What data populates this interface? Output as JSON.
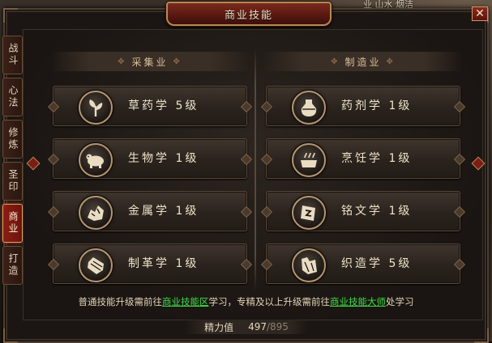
{
  "topright_text": "业   山水   烟洁",
  "window": {
    "title": "商业技能",
    "close_label": "✕"
  },
  "side_tabs": [
    {
      "label": "战斗",
      "active": false
    },
    {
      "label": "心法",
      "active": false
    },
    {
      "label": "修炼",
      "active": false
    },
    {
      "label": "圣印",
      "active": false
    },
    {
      "label": "商业",
      "active": true
    },
    {
      "label": "打造",
      "active": false
    }
  ],
  "columns": [
    {
      "header": "采集业",
      "skills": [
        {
          "label": "草药学  5级",
          "icon": "herb-icon"
        },
        {
          "label": "生物学  1级",
          "icon": "creature-icon"
        },
        {
          "label": "金属学  1级",
          "icon": "ore-icon"
        },
        {
          "label": "制革学  1级",
          "icon": "leather-icon"
        }
      ]
    },
    {
      "header": "制造业",
      "skills": [
        {
          "label": "药剂学  1级",
          "icon": "potion-icon"
        },
        {
          "label": "烹饪学  1级",
          "icon": "cooking-pot-icon"
        },
        {
          "label": "铭文学  1级",
          "icon": "inscription-icon"
        },
        {
          "label": "织造学  5级",
          "icon": "weaving-icon"
        }
      ]
    }
  ],
  "hint": {
    "part1": "普通技能升级需前往",
    "link1": "商业技能区",
    "part2": "学习，专精及以上升级需前往",
    "link2": "商业技能大师",
    "part3": "处学习"
  },
  "energy": {
    "label": "精力值",
    "current": "497",
    "max": "/895"
  },
  "colors": {
    "active_tab": "#8a1e14",
    "link": "#3fdc4a",
    "gold_border": "#b58a55"
  }
}
